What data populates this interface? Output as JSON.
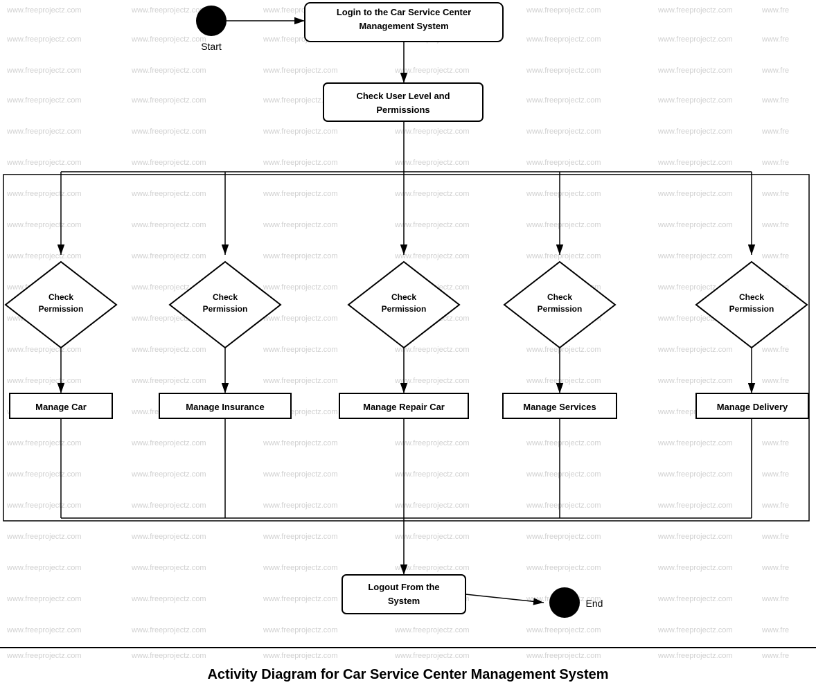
{
  "diagram": {
    "title": "Activity Diagram for Car Service Center Management System",
    "watermark": "www.freeprojectz.com",
    "nodes": {
      "start_label": "Start",
      "login_box": "Login to the Car Service Center Management System",
      "check_user": "Check User Level and Permissions",
      "check_perm1": "Check\nPermission",
      "check_perm2": "Check\nPermission",
      "check_perm3": "Check\nPermission",
      "check_perm4": "Check\nPermission",
      "check_perm5": "Check\nPermission",
      "manage_car": "Manage Car",
      "manage_insurance": "Manage Insurance",
      "manage_repair": "Manage Repair Car",
      "manage_services": "Manage Services",
      "manage_delivery": "Manage Delivery",
      "logout_box": "Logout From the System",
      "end_label": "End"
    }
  }
}
